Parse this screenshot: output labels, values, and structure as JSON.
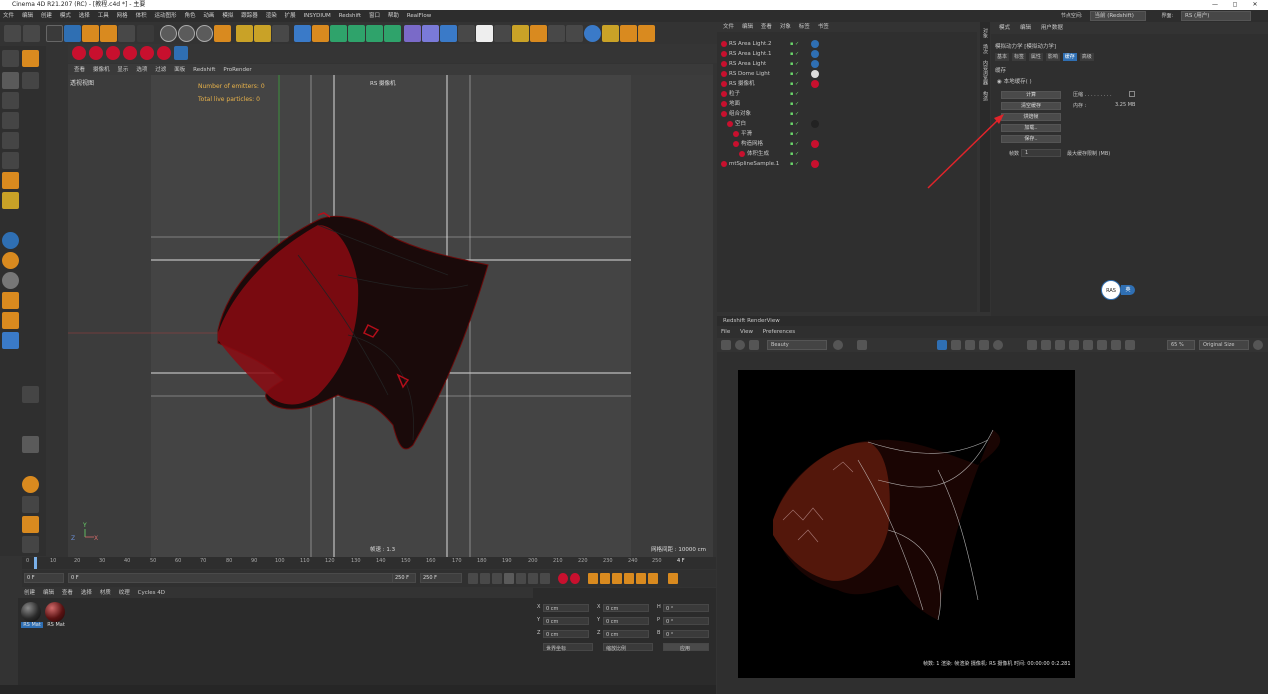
{
  "window": {
    "title": "Cinema 4D R21.207 (RC) - [教程.c4d *] - 主要",
    "min": "—",
    "max": "◻",
    "close": "✕"
  },
  "menubar": {
    "items": [
      "文件",
      "编辑",
      "创建",
      "模式",
      "选择",
      "工具",
      "网格",
      "体积",
      "运动图形",
      "角色",
      "动画",
      "模拟",
      "跟踪器",
      "渲染",
      "扩展",
      "INSYDIUM",
      "Redshift",
      "窗口",
      "帮助",
      "RealFlow"
    ],
    "layout_label": "界面:",
    "layout_value": "RS (用户)",
    "node_label": "节点空间:",
    "node_value": "当前 (Redshift)"
  },
  "viewport": {
    "menu": [
      "查看",
      "摄像机",
      "显示",
      "选项",
      "过滤",
      "面板",
      "Redshift",
      "ProRender"
    ],
    "camera_label": "透视视图",
    "rs_camera": "RS 摄像机",
    "emitters_label": "Number of emitters: 0",
    "particles_label": "Total live particles: 0",
    "fps_label": "帧速 : 1.3",
    "grid_label": "网格间距 : 10000 cm",
    "axis_y": "Y",
    "axis_x": "X",
    "axis_z": "Z"
  },
  "timeline": {
    "ticks": [
      "0",
      "10",
      "20",
      "30",
      "40",
      "50",
      "60",
      "70",
      "80",
      "90",
      "100",
      "110",
      "120",
      "130",
      "140",
      "150",
      "160",
      "170",
      "180",
      "190",
      "200",
      "210",
      "220",
      "230",
      "240",
      "250"
    ],
    "current_frame": "4 F"
  },
  "transport": {
    "start": "0 F",
    "current": "0 F",
    "end_a": "250 F",
    "end_b": "250 F"
  },
  "materials": {
    "tabs": [
      "创建",
      "编辑",
      "查看",
      "选择",
      "材质",
      "纹理",
      "Cycles 4D"
    ],
    "items": [
      {
        "label": "RS Mat",
        "selected": true
      },
      {
        "label": "RS Mat",
        "selected": false
      }
    ]
  },
  "coords": {
    "rows": [
      {
        "a": "X",
        "av": "0 cm",
        "b": "X",
        "bv": "0 cm",
        "c": "H",
        "cv": "0 °"
      },
      {
        "a": "Y",
        "av": "0 cm",
        "b": "Y",
        "bv": "0 cm",
        "c": "P",
        "cv": "0 °"
      },
      {
        "a": "Z",
        "av": "0 cm",
        "b": "Z",
        "bv": "0 cm",
        "c": "B",
        "cv": "0 °"
      }
    ],
    "mode_a": "世界坐标",
    "mode_b": "缩放比例",
    "apply": "应用"
  },
  "objects": {
    "menu": [
      "文件",
      "编辑",
      "查看",
      "对象",
      "标签",
      "书签"
    ],
    "rows": [
      {
        "name": "RS Area Light.2",
        "indent": 0,
        "tag": "#2f6fb3"
      },
      {
        "name": "RS Area Light.1",
        "indent": 0,
        "tag": "#2f6fb3"
      },
      {
        "name": "RS Area Light",
        "indent": 0,
        "tag": "#2f6fb3"
      },
      {
        "name": "RS Dome Light",
        "indent": 0,
        "tag": "#dddddd"
      },
      {
        "name": "RS 摄像机",
        "indent": 0,
        "tag": "#c8102e"
      },
      {
        "name": "粒子",
        "indent": 0,
        "tag": ""
      },
      {
        "name": "地面",
        "indent": 0,
        "tag": ""
      },
      {
        "name": "组合对象",
        "indent": 0,
        "tag": ""
      },
      {
        "name": "空白",
        "indent": 1,
        "tag": "#222222"
      },
      {
        "name": "平滑",
        "indent": 2,
        "tag": ""
      },
      {
        "name": "构造网格",
        "indent": 2,
        "tag": "#c8102e"
      },
      {
        "name": "体积生成",
        "indent": 3,
        "tag": ""
      },
      {
        "name": "mtSplineSample.1",
        "indent": 0,
        "tag": "#c8102e"
      }
    ]
  },
  "attributes": {
    "menu": [
      "模式",
      "编辑",
      "用户数据"
    ],
    "title": "模拟动力学 [模拟动力学]",
    "tabs": [
      "基本",
      "标签",
      "属性",
      "影响",
      "缓存",
      "高级"
    ],
    "active_tab": "缓存",
    "section": "缓存",
    "local_cache": "本地缓存(  )",
    "compress": "压缩 . . . . . . . . .",
    "memory_label": "内存 :",
    "memory_value": "3.25 MB",
    "buttons": [
      "计算",
      "清空缓存",
      "烘焙帧",
      "加载..",
      "保存.."
    ],
    "frames_label": "帧数",
    "frames_value": "1",
    "max_label": "最大缓存限制 (MB)"
  },
  "side_tabs": [
    "对象",
    "场次",
    "内容浏览器",
    "构造"
  ],
  "render_view": {
    "title": "Redshift RenderView",
    "menu": [
      "File",
      "View",
      "Preferences"
    ],
    "mode": "Beauty",
    "zoom": "65 %",
    "color": "Original Size",
    "status": "帧数: 1   渲染: 帧渲染   摄像机: RS 摄像机   时间: 00:00:00   0:2.281"
  },
  "floating_badge": "RAS",
  "floating_badge_tail": "英"
}
